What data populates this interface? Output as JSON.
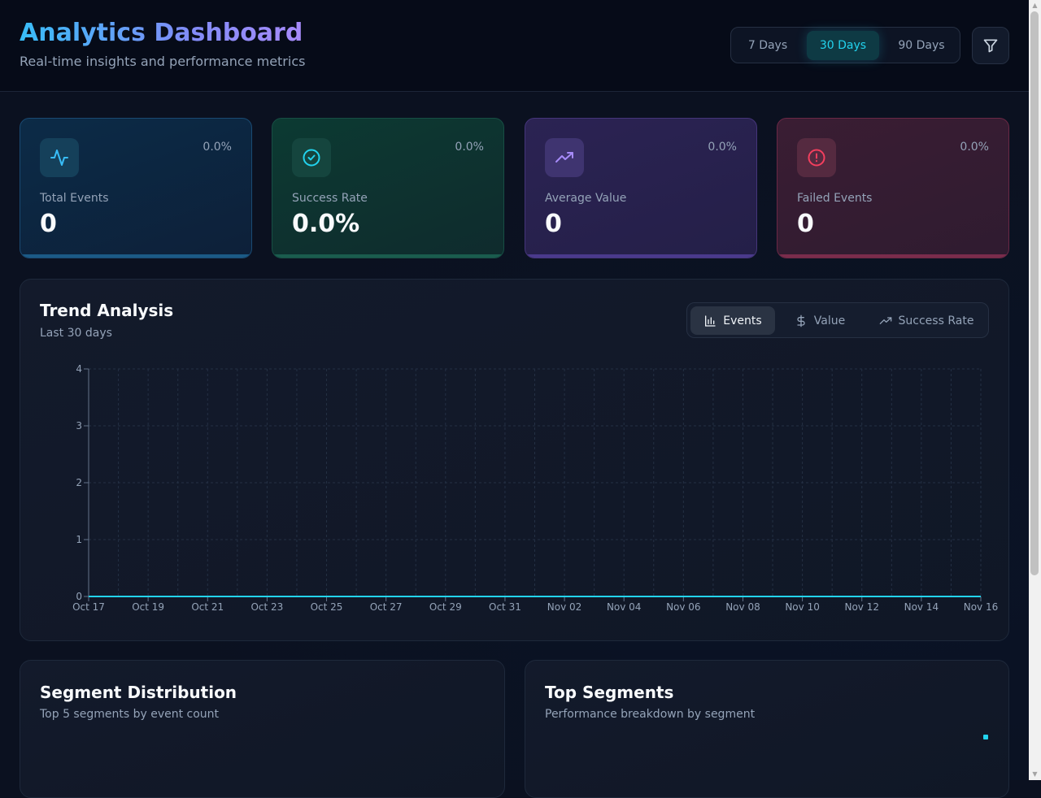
{
  "header": {
    "title": "Analytics Dashboard",
    "subtitle": "Real-time insights and performance metrics",
    "ranges": [
      "7 Days",
      "30 Days",
      "90 Days"
    ],
    "active_range": "30 Days"
  },
  "stats": [
    {
      "label": "Total Events",
      "value": "0",
      "change": "0.0%",
      "icon": "activity-icon",
      "accent": "#38bdf8"
    },
    {
      "label": "Success Rate",
      "value": "0.0%",
      "change": "0.0%",
      "icon": "check-circle-icon",
      "accent": "#22d3ee"
    },
    {
      "label": "Average Value",
      "value": "0",
      "change": "0.0%",
      "icon": "trending-up-icon",
      "accent": "#a78bfa"
    },
    {
      "label": "Failed Events",
      "value": "0",
      "change": "0.0%",
      "icon": "alert-circle-icon",
      "accent": "#f43f5e"
    }
  ],
  "trend": {
    "title": "Trend Analysis",
    "subtitle": "Last 30 days",
    "tabs": [
      {
        "label": "Events",
        "icon": "bar-chart-icon"
      },
      {
        "label": "Value",
        "icon": "dollar-icon"
      },
      {
        "label": "Success Rate",
        "icon": "trending-up-icon"
      }
    ],
    "active_tab": "Events"
  },
  "chart_data": {
    "type": "line",
    "x": [
      "Oct 17",
      "Oct 18",
      "Oct 19",
      "Oct 20",
      "Oct 21",
      "Oct 22",
      "Oct 23",
      "Oct 24",
      "Oct 25",
      "Oct 26",
      "Oct 27",
      "Oct 28",
      "Oct 29",
      "Oct 30",
      "Oct 31",
      "Nov 01",
      "Nov 02",
      "Nov 03",
      "Nov 04",
      "Nov 05",
      "Nov 06",
      "Nov 07",
      "Nov 08",
      "Nov 09",
      "Nov 10",
      "Nov 11",
      "Nov 12",
      "Nov 13",
      "Nov 14",
      "Nov 15",
      "Nov 16"
    ],
    "x_tick_labels": [
      "Oct 17",
      "Oct 19",
      "Oct 21",
      "Oct 23",
      "Oct 25",
      "Oct 27",
      "Oct 29",
      "Oct 31",
      "Nov 02",
      "Nov 04",
      "Nov 06",
      "Nov 08",
      "Nov 10",
      "Nov 12",
      "Nov 14",
      "Nov 16"
    ],
    "series": [
      {
        "values": [
          0,
          0,
          0,
          0,
          0,
          0,
          0,
          0,
          0,
          0,
          0,
          0,
          0,
          0,
          0,
          0,
          0,
          0,
          0,
          0,
          0,
          0,
          0,
          0,
          0,
          0,
          0,
          0,
          0,
          0,
          0
        ],
        "color": "#22d3ee"
      }
    ],
    "y_ticks": [
      0,
      1,
      2,
      3,
      4
    ],
    "ylim": [
      0,
      4
    ],
    "grid": true,
    "title": "",
    "xlabel": "",
    "ylabel": ""
  },
  "segments": {
    "title": "Segment Distribution",
    "subtitle": "Top 5 segments by event count"
  },
  "top_segments": {
    "title": "Top Segments",
    "subtitle": "Performance breakdown by segment"
  },
  "colors": {
    "accent_cyan": "#22d3ee",
    "background": "#0b1120"
  }
}
